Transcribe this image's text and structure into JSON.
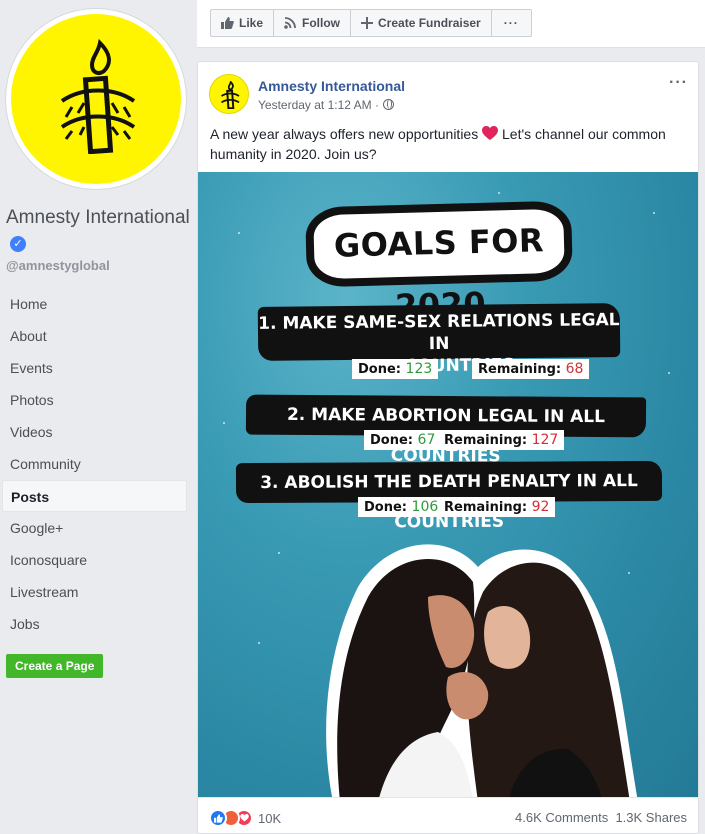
{
  "sidebar": {
    "page_name": "Amnesty International",
    "handle": "@amnestyglobal",
    "nav": [
      {
        "label": "Home",
        "active": false
      },
      {
        "label": "About",
        "active": false
      },
      {
        "label": "Events",
        "active": false
      },
      {
        "label": "Photos",
        "active": false
      },
      {
        "label": "Videos",
        "active": false
      },
      {
        "label": "Community",
        "active": false
      },
      {
        "label": "Posts",
        "active": true
      },
      {
        "label": "Google+",
        "active": false
      },
      {
        "label": "Iconosquare",
        "active": false
      },
      {
        "label": "Livestream",
        "active": false
      },
      {
        "label": "Jobs",
        "active": false
      }
    ],
    "create_page_label": "Create a Page"
  },
  "actionbar": {
    "like_label": "Like",
    "follow_label": "Follow",
    "fundraiser_label": "Create Fundraiser",
    "more_label": "···"
  },
  "post": {
    "author": "Amnesty International",
    "timestamp": "Yesterday at 1:12 AM ·",
    "text_before": "A new year always offers new opportunities",
    "text_after": " Let's channel our common humanity in 2020. Join us?",
    "image": {
      "title": "GOALS FOR 2020",
      "goals": [
        {
          "line1": "1. MAKE SAME-SEX RELATIONS LEGAL IN",
          "line2": "ALL COUNTRIES",
          "done_label": "Done:",
          "done": "123",
          "remaining_label": "Remaining:",
          "remaining": "68"
        },
        {
          "line1": "2. MAKE ABORTION LEGAL IN ALL COUNTRIES",
          "line2": "",
          "done_label": "Done:",
          "done": "67",
          "remaining_label": "Remaining:",
          "remaining": "127"
        },
        {
          "line1": "3. ABOLISH THE DEATH PENALTY IN ALL COUNTRIES",
          "line2": "",
          "done_label": "Done:",
          "done": "106",
          "remaining_label": "Remaining:",
          "remaining": "92"
        }
      ]
    },
    "reactions_count": "10K",
    "comments": "4.6K Comments",
    "shares": "1.3K Shares"
  },
  "colors": {
    "brand_yellow": "#fff500",
    "link_blue": "#365899",
    "create_green": "#42b72a",
    "image_teal": "#2b88a4"
  }
}
